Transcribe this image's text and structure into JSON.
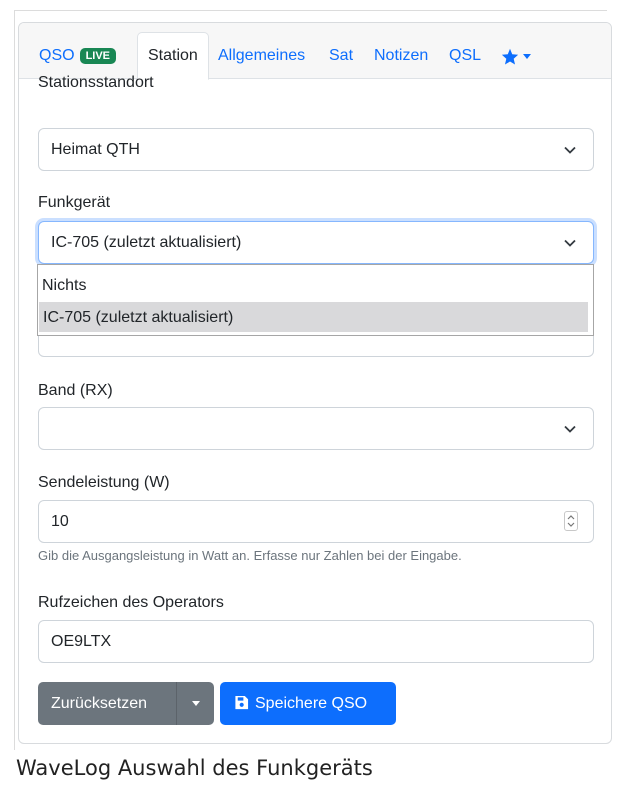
{
  "tabs": [
    {
      "label": "QSO",
      "badge": "LIVE"
    },
    {
      "label": "Station"
    },
    {
      "label": "Allgemeines"
    },
    {
      "label": "Sat"
    },
    {
      "label": "Notizen"
    },
    {
      "label": "QSL"
    }
  ],
  "favorites_icon": "star-icon",
  "form": {
    "station_location": {
      "label": "Stationsstandort",
      "value": "Heimat QTH"
    },
    "radio": {
      "label": "Funkgerät",
      "value": "IC-705 (zuletzt aktualisiert)",
      "options": [
        "Nichts",
        "IC-705 (zuletzt aktualisiert)"
      ]
    },
    "band_rx": {
      "label": "Band (RX)",
      "value": ""
    },
    "power": {
      "label": "Sendeleistung (W)",
      "value": "10",
      "help": "Gib die Ausgangsleistung in Watt an. Erfasse nur Zahlen bei der Eingabe."
    },
    "operator": {
      "label": "Rufzeichen des Operators",
      "value": "OE9LTX"
    }
  },
  "buttons": {
    "reset": "Zurücksetzen",
    "save": "Speichere QSO"
  },
  "caption": "WaveLog Auswahl des Funkgeräts",
  "colors": {
    "primary": "#0d6efd",
    "secondary": "#6c757d",
    "live_badge": "#198754"
  }
}
